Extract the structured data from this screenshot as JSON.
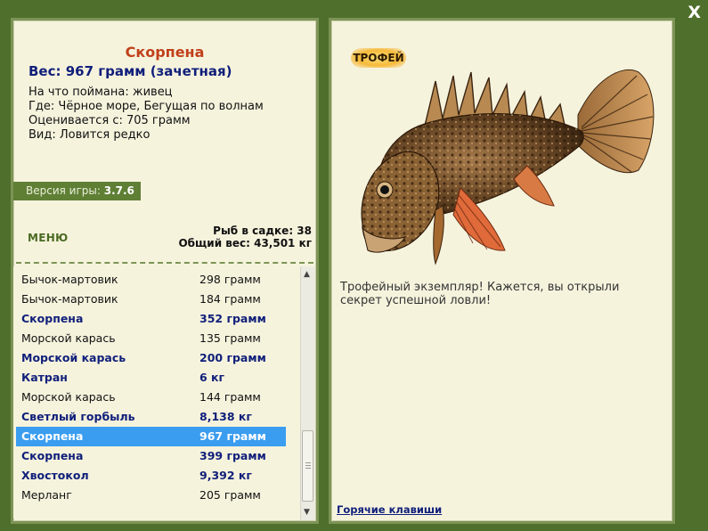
{
  "close_label": "X",
  "fish": {
    "name": "Скорпена",
    "weight_line": "Вес: 967 грамм (зачетная)",
    "info": [
      "На что поймана: живец",
      "Где: Чёрное море, Бегущая по волнам",
      "Оценивается с: 705 грамм",
      "Вид: Ловится редко"
    ]
  },
  "version": {
    "label": "Версия игры:",
    "value": "3.7.6"
  },
  "menu_label": "МЕНЮ",
  "stats": {
    "fish_count": "Рыб в садке: 38",
    "total_weight": "Общий вес: 43,501 кг"
  },
  "catch_list": [
    {
      "name": "Бычок-мартовик",
      "weight": "298 грамм",
      "highlight": false,
      "selected": false
    },
    {
      "name": "Бычок-мартовик",
      "weight": "184 грамм",
      "highlight": false,
      "selected": false
    },
    {
      "name": "Скорпена",
      "weight": "352 грамм",
      "highlight": true,
      "selected": false
    },
    {
      "name": "Морской карась",
      "weight": "135 грамм",
      "highlight": false,
      "selected": false
    },
    {
      "name": "Морской карась",
      "weight": "200 грамм",
      "highlight": true,
      "selected": false
    },
    {
      "name": "Катран",
      "weight": "6 кг",
      "highlight": true,
      "selected": false
    },
    {
      "name": "Морской карась",
      "weight": "144 грамм",
      "highlight": false,
      "selected": false
    },
    {
      "name": "Светлый горбыль",
      "weight": "8,138 кг",
      "highlight": true,
      "selected": false
    },
    {
      "name": "Скорпена",
      "weight": "967 грамм",
      "highlight": true,
      "selected": true
    },
    {
      "name": "Скорпена",
      "weight": "399 грамм",
      "highlight": true,
      "selected": false
    },
    {
      "name": "Хвостокол",
      "weight": "9,392 кг",
      "highlight": true,
      "selected": false
    },
    {
      "name": "Мерланг",
      "weight": "205 грамм",
      "highlight": false,
      "selected": false
    }
  ],
  "trophy_label": "ТРОФЕЙ",
  "trophy_text": "Трофейный экземпляр! Кажется, вы открыли секрет успешной ловли!",
  "hotkeys_label": "Горячие клавиши",
  "icons": {
    "close": "close-icon",
    "scroll_up": "scroll-up-arrow-icon",
    "scroll_down": "scroll-down-arrow-icon"
  },
  "colors": {
    "background": "#4f6f2c",
    "panel": "#f6f3dd",
    "panel_border": "#7d9456",
    "title_red": "#c0401a",
    "accent_blue": "#101f7a",
    "selection": "#3a9df0"
  }
}
